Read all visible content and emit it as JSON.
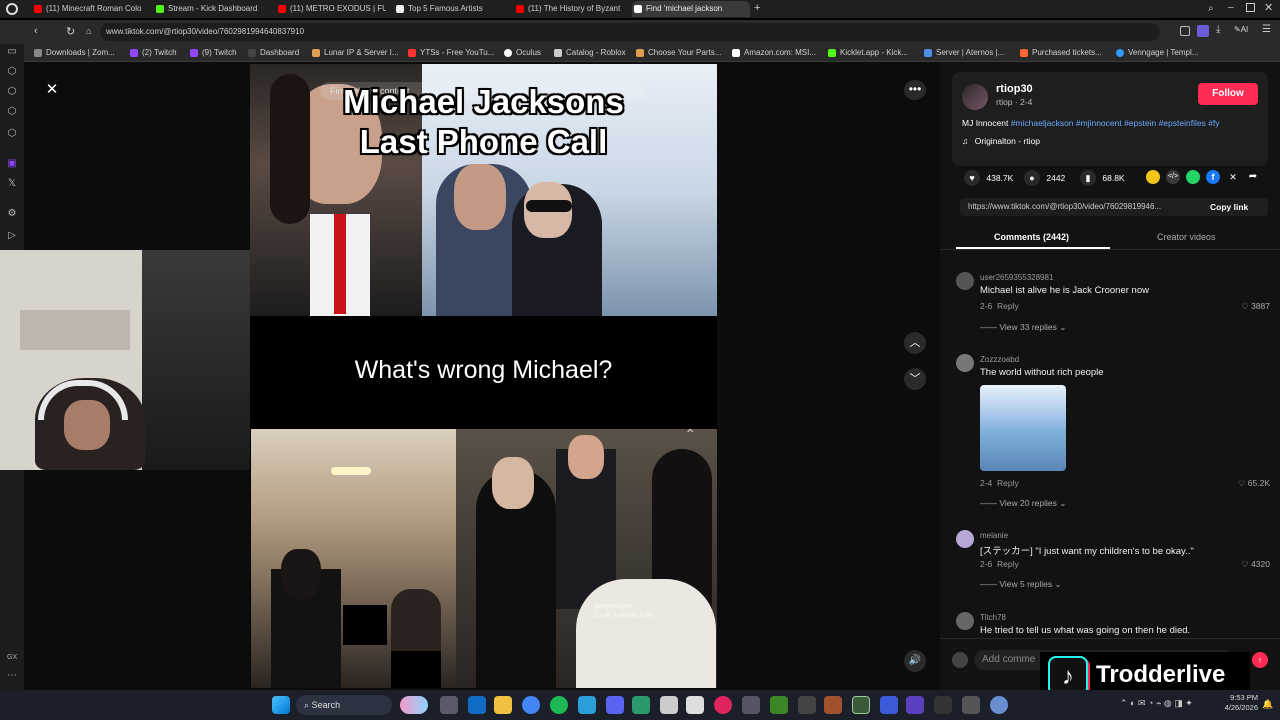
{
  "browser": {
    "tabs": [
      {
        "label": "(11) Minecraft Roman Colo",
        "color": "#ff0000"
      },
      {
        "label": "Stream - Kick Dashboard",
        "color": "#53fc18"
      },
      {
        "label": "(11) METRO EXODUS | FU",
        "color": "#ff0000"
      },
      {
        "label": "Top 5 Famous Artists",
        "color": "#eeeeee"
      },
      {
        "label": "(11) The History of Byzant",
        "color": "#ff0000"
      },
      {
        "label": "Find 'michael jackson",
        "color": "#ffffff"
      }
    ],
    "url": "www.tiktok.com/@rtiop30/video/7602981994640837910",
    "bookmarks": [
      {
        "label": "Downloads | Zom...",
        "color": "#888888"
      },
      {
        "label": "(2) Twitch",
        "color": "#9146ff"
      },
      {
        "label": "(9) Twitch",
        "color": "#9146ff"
      },
      {
        "label": "Dashboard",
        "color": "#444444"
      },
      {
        "label": "Lunar IP & Server I...",
        "color": "#e0a050"
      },
      {
        "label": "YTSs - Free YouTu...",
        "color": "#ff3333"
      },
      {
        "label": "Oculus",
        "color": "#ffffff"
      },
      {
        "label": "Catalog - Roblox",
        "color": "#cccccc"
      },
      {
        "label": "Choose Your Parts...",
        "color": "#e0a050"
      },
      {
        "label": "Amazon.com: MSI...",
        "color": "#ffffff"
      },
      {
        "label": "Kicklet.app - Kick...",
        "color": "#53fc18"
      },
      {
        "label": "Server | Aternos |...",
        "color": "#4a90e2"
      },
      {
        "label": "Purchased tickets...",
        "color": "#ff6633"
      },
      {
        "label": "Venngage | Templ...",
        "color": "#3399ff"
      }
    ]
  },
  "video": {
    "title_line1": "Michael Jacksons",
    "title_line2": "Last Phone Call",
    "caption": "What's wrong Michael?",
    "search_overlay": "Find related content",
    "watermark": "gettyimages",
    "credit": "Credit: Jonathan Exley"
  },
  "post": {
    "username": "rtiop30",
    "subline": "rtiop · 2-4",
    "follow_label": "Follow",
    "caption_text": "MJ Innocent",
    "hashtags": "#michaeljackson #mjinnocent #epstein #epsteinfiles #fy",
    "sound": "Originalton - rtiop",
    "likes": "438.7K",
    "comments": "2442",
    "saves": "68.8K",
    "link": "https://www.tiktok.com/@rtiop30/video/76029819946...",
    "copy_link": "Copy link",
    "tab_comments": "Comments (2442)",
    "tab_creator": "Creator videos"
  },
  "comments": [
    {
      "user": "user2659355328981",
      "text": "Michael ist alive he is Jack Crooner now",
      "date": "2-6",
      "reply": "Reply",
      "likes": "3887",
      "replies": "View 33 replies"
    },
    {
      "user": "Zozzzoabd",
      "text": "The world without rich people",
      "date": "2-4",
      "reply": "Reply",
      "likes": "65.2K",
      "replies": "View 20 replies"
    },
    {
      "user": "melanie",
      "text": "[ステッカー] \"I just want my children's to be okay..\"",
      "date": "2-6",
      "reply": "Reply",
      "likes": "4320",
      "replies": "View 5 replies"
    },
    {
      "user": "Titch78",
      "text": "He tried to tell us what was going on then he died."
    }
  ],
  "add_comment_placeholder": "Add comme",
  "stream": {
    "brand": "Trodderlive"
  },
  "taskbar": {
    "search_label": "Search",
    "time": "9:53 PM",
    "date": "4/26/2026"
  },
  "rail_bottom": "GX"
}
